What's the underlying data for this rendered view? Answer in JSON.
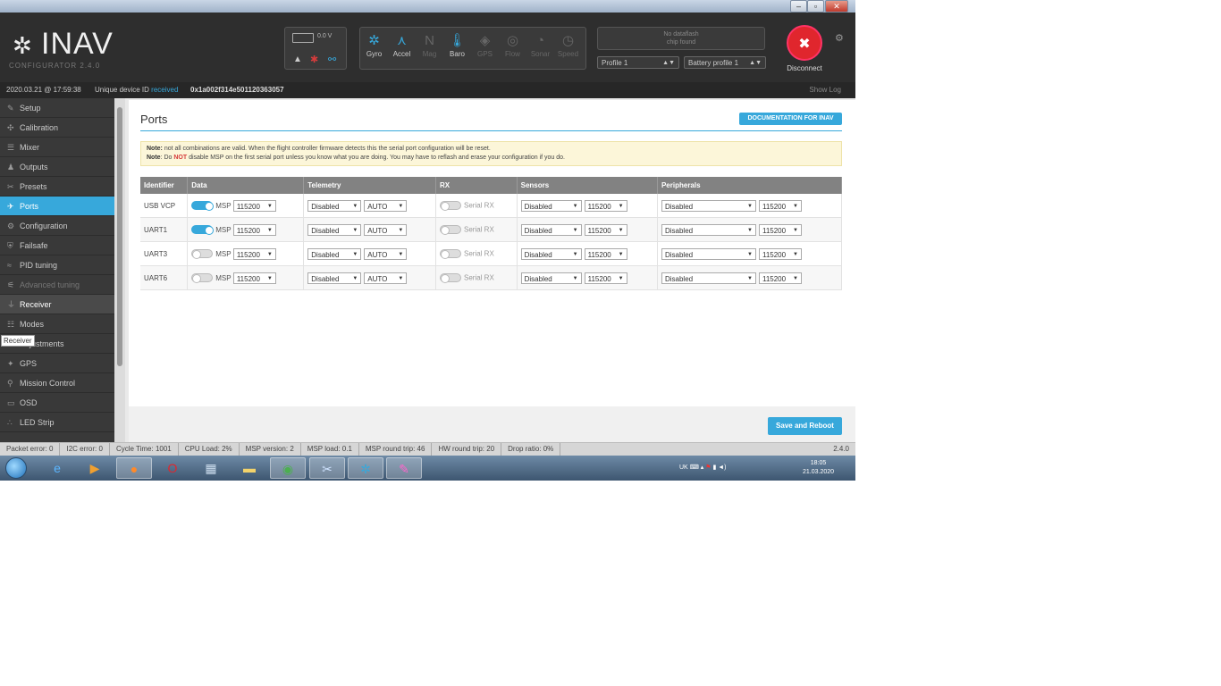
{
  "header": {
    "app_name": "INAV",
    "app_sub": "CONFIGURATOR  2.4.0",
    "battery_voltage": "0.0 V",
    "sensors": [
      {
        "label": "Gyro",
        "icon": "gyro-icon",
        "active": true
      },
      {
        "label": "Accel",
        "icon": "accel-icon",
        "active": true
      },
      {
        "label": "Mag",
        "icon": "mag-icon",
        "active": false
      },
      {
        "label": "Baro",
        "icon": "baro-icon",
        "active": true
      },
      {
        "label": "GPS",
        "icon": "gps-icon",
        "active": false
      },
      {
        "label": "Flow",
        "icon": "flow-icon",
        "active": false
      },
      {
        "label": "Sonar",
        "icon": "sonar-icon",
        "active": false
      },
      {
        "label": "Speed",
        "icon": "speed-icon",
        "active": false
      }
    ],
    "fc_line1": "No dataflash",
    "fc_line2": "chip found",
    "profile": "Profile 1",
    "battery_profile": "Battery profile 1",
    "disconnect": "Disconnect"
  },
  "infobar": {
    "datetime": "2020.03.21 @ 17:59:38",
    "uid_label": "Unique device ID",
    "uid_status": "received",
    "uid_value": "0x1a002f314e501120363057",
    "show_log": "Show Log"
  },
  "sidebar": {
    "items": [
      {
        "label": "Setup",
        "icon": "wrench-icon"
      },
      {
        "label": "Calibration",
        "icon": "calibration-icon"
      },
      {
        "label": "Mixer",
        "icon": "mixer-icon"
      },
      {
        "label": "Outputs",
        "icon": "outputs-icon"
      },
      {
        "label": "Presets",
        "icon": "presets-icon"
      },
      {
        "label": "Ports",
        "icon": "ports-icon"
      },
      {
        "label": "Configuration",
        "icon": "gear-icon"
      },
      {
        "label": "Failsafe",
        "icon": "failsafe-icon"
      },
      {
        "label": "PID tuning",
        "icon": "pid-icon"
      },
      {
        "label": "Advanced tuning",
        "icon": "advanced-icon"
      },
      {
        "label": "Receiver",
        "icon": "receiver-icon"
      },
      {
        "label": "Modes",
        "icon": "modes-icon"
      },
      {
        "label": "Adjustments",
        "icon": "adjustments-icon"
      },
      {
        "label": "GPS",
        "icon": "satellite-icon"
      },
      {
        "label": "Mission Control",
        "icon": "map-pin-icon"
      },
      {
        "label": "OSD",
        "icon": "osd-icon"
      },
      {
        "label": "LED Strip",
        "icon": "led-icon"
      }
    ],
    "tooltip": "Receiver"
  },
  "main": {
    "title": "Ports",
    "doc_button": "DOCUMENTATION FOR INAV",
    "note1_bold": "Note:",
    "note1": " not all combinations are valid. When the flight controller firmware detects this the serial port configuration will be reset.",
    "note2_bold": "Note",
    "note2_a": ": Do ",
    "note2_red": "NOT",
    "note2_b": " disable MSP on the first serial port unless you know what you are doing. You may have to reflash and erase your configuration if you do.",
    "columns": [
      "Identifier",
      "Data",
      "Telemetry",
      "RX",
      "Sensors",
      "Peripherals"
    ],
    "msp_label": "MSP",
    "rx_label": "Serial RX",
    "rows": [
      {
        "id": "USB VCP",
        "msp_on": true,
        "msp_baud": "115200",
        "telemetry": "Disabled",
        "telemetry_baud": "AUTO",
        "rx_on": false,
        "sensors": "Disabled",
        "sensors_baud": "115200",
        "peripherals": "Disabled",
        "peripherals_baud": "115200"
      },
      {
        "id": "UART1",
        "msp_on": true,
        "msp_baud": "115200",
        "telemetry": "Disabled",
        "telemetry_baud": "AUTO",
        "rx_on": false,
        "sensors": "Disabled",
        "sensors_baud": "115200",
        "peripherals": "Disabled",
        "peripherals_baud": "115200"
      },
      {
        "id": "UART3",
        "msp_on": false,
        "msp_baud": "115200",
        "telemetry": "Disabled",
        "telemetry_baud": "AUTO",
        "rx_on": false,
        "sensors": "Disabled",
        "sensors_baud": "115200",
        "peripherals": "Disabled",
        "peripherals_baud": "115200"
      },
      {
        "id": "UART6",
        "msp_on": false,
        "msp_baud": "115200",
        "telemetry": "Disabled",
        "telemetry_baud": "AUTO",
        "rx_on": false,
        "sensors": "Disabled",
        "sensors_baud": "115200",
        "peripherals": "Disabled",
        "peripherals_baud": "115200"
      }
    ],
    "save_button": "Save and Reboot"
  },
  "statusbar": {
    "packet_error": "Packet error: 0",
    "i2c_error": "I2C error: 0",
    "cycle_time": "Cycle Time: 1001",
    "cpu_load": "CPU Load: 2%",
    "msp_version": "MSP version: 2",
    "msp_load": "MSP load: 0.1",
    "msp_roundtrip": "MSP round trip: 46",
    "hw_roundtrip": "HW round trip: 20",
    "drop_ratio": "Drop ratio: 0%",
    "version": "2.4.0"
  },
  "taskbar": {
    "lang": "UK",
    "time": "18:05",
    "date": "21.03.2020"
  },
  "colors": {
    "accent": "#37a8db",
    "danger": "#e0262d",
    "header_bg": "#2e2e2e",
    "sidebar_bg": "#393939"
  }
}
